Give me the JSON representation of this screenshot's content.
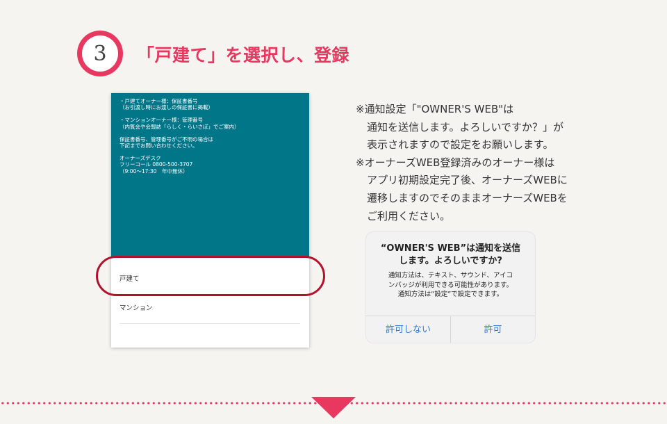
{
  "step": {
    "number": "3",
    "title": "「戸建て」を選択し、登録"
  },
  "phone": {
    "info_lines": [
      "・戸建てオーナー様：保証書番号",
      "（お引渡し時にお渡しの保証書に掲載）",
      "",
      "・マンションオーナー様：管理番号",
      "（内覧会や会報誌「らしく・らいさぽ」でご案内）",
      "",
      "保証書番号、管理番号がご不明の場合は",
      "下記までお問い合わせください。",
      "",
      "オーナーズデスク",
      "フリーコール 0800-500-3707",
      "（9:00〜17:30　年中無休）"
    ],
    "options": [
      "戸建て",
      "マンション"
    ]
  },
  "notes": [
    "※通知設定「\"OWNER'S WEB\"は",
    "通知を送信します。よろしいですか？」が",
    "表示されますので設定をお願いします。",
    "※オーナーズWEB登録済みのオーナー様は",
    "アプリ初期設定完了後、オーナーズWEBに",
    "遷移しますのでそのままオーナーズWEBを",
    "ご利用ください。"
  ],
  "dialog": {
    "title_line1": "“OWNER'S WEB”は通知を送信",
    "title_line2": "します。よろしいですか?",
    "message_line1": "通知方法は、テキスト、サウンド、アイコ",
    "message_line2": "ンバッジが利用できる可能性があります。",
    "message_line3": "通知方法は“設定”で設定できます。",
    "deny_label": "許可しない",
    "allow_label": "許可"
  },
  "colors": {
    "accent": "#e8385f",
    "phone_header": "#017689",
    "highlight": "#b3122c",
    "dialog_button": "#2f7ed6"
  },
  "icons": {
    "scroll_indicator": "down-triangle-icon"
  }
}
